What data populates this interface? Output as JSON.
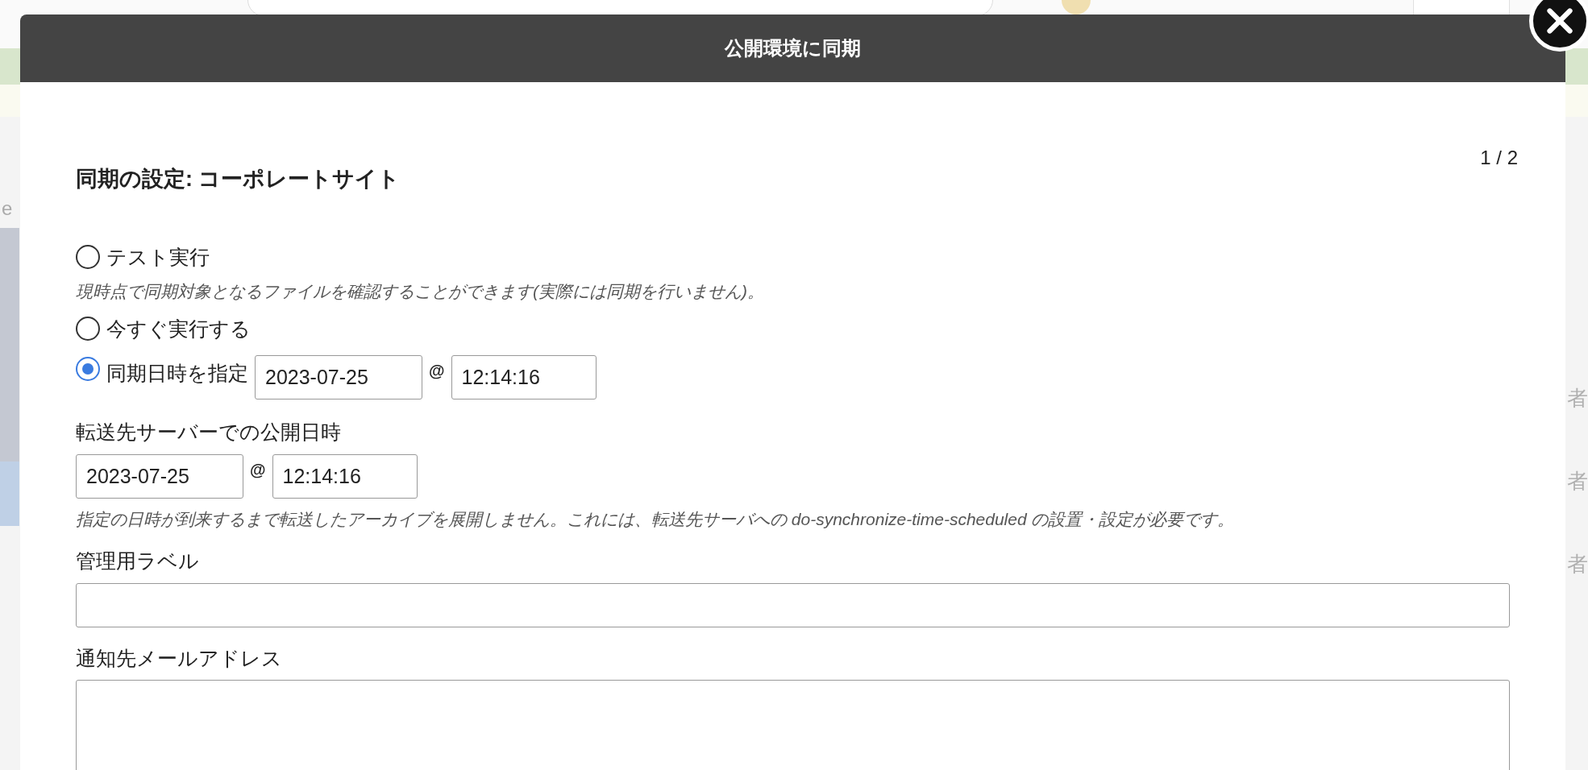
{
  "background": {
    "left_fragments": [
      "e"
    ],
    "right_fragments": [
      "者",
      "者",
      "者"
    ]
  },
  "dialog": {
    "title": "公開環境に同期",
    "step": "1 / 2",
    "heading": "同期の設定: コーポレートサイト",
    "modes": [
      {
        "kind": "plain",
        "label": "テスト実行",
        "hint": "現時点で同期対象となるファイルを確認することができます(実際には同期を行いません)。",
        "selected": false
      },
      {
        "kind": "plain",
        "label": "今すぐ実行する",
        "selected": false
      },
      {
        "kind": "datetime",
        "label": "同期日時を指定",
        "date": "2023-07-25",
        "separator": "@",
        "time": "12:14:16",
        "selected": true
      }
    ],
    "publish": {
      "label": "転送先サーバーでの公開日時",
      "date": "2023-07-25",
      "separator": "@",
      "time": "12:14:16",
      "hint": "指定の日時が到来するまで転送したアーカイブを展開しません。これには、転送先サーバへの do-synchronize-time-scheduled の設置・設定が必要です。"
    },
    "label_field": {
      "label": "管理用ラベル"
    },
    "email_field": {
      "label": "通知先メールアドレス"
    }
  }
}
